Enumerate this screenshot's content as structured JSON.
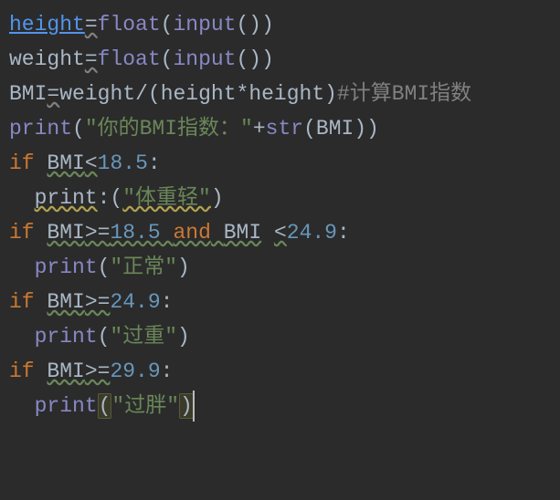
{
  "code": {
    "line1": {
      "height": "height",
      "eq": "=",
      "float": "float",
      "lp": "(",
      "input": "input",
      "lp2": "(",
      "rp2": ")",
      "rp": ")"
    },
    "line2": {
      "weight": "weight",
      "eq": "=",
      "float": "float",
      "lp": "(",
      "input": "input",
      "lp2": "(",
      "rp2": ")",
      "rp": ")"
    },
    "line3": {
      "bmi": "BMI",
      "eq": "=",
      "weight": "weight",
      "div": "/",
      "lp": "(",
      "height1": "height",
      "mul": "*",
      "height2": "height",
      "rp": ")",
      "comment": "#计算BMI指数"
    },
    "line4": {
      "print": "print",
      "lp": "(",
      "s1": "\"你的BMI指数：\"",
      "plus": "+",
      "strfn": "str",
      "lp2": "(",
      "bmi": "BMI",
      "rp2": ")",
      "rp": ")"
    },
    "line5": {
      "if": "if",
      "bmi": "BMI",
      "lt": "<",
      "n": "18.5",
      "colon": ":"
    },
    "line6": {
      "print": "print",
      "colon": ":",
      "lp": "(",
      "s": "\"体重轻\"",
      "rp": ")"
    },
    "line7": {
      "if": "if",
      "bmi1": "BMI",
      "ge1": ">=",
      "n1": "18.5",
      "and": "and",
      "bmi2": "BMI",
      "lt": "<",
      "n2": "24.9",
      "colon": ":"
    },
    "line8": {
      "print": "print",
      "lp": "(",
      "s": "\"正常\"",
      "rp": ")"
    },
    "line9": {
      "if": "if",
      "bmi": "BMI",
      "ge": ">=",
      "n": "24.9",
      "colon": ":"
    },
    "line10": {
      "print": "print",
      "lp": "(",
      "s": "\"过重\"",
      "rp": ")"
    },
    "line11": {
      "if": "if",
      "bmi": "BMI",
      "ge": ">=",
      "n": "29.9",
      "colon": ":"
    },
    "line12": {
      "print": "print",
      "lp": "(",
      "s": "\"过胖\"",
      "rp": ")"
    }
  }
}
